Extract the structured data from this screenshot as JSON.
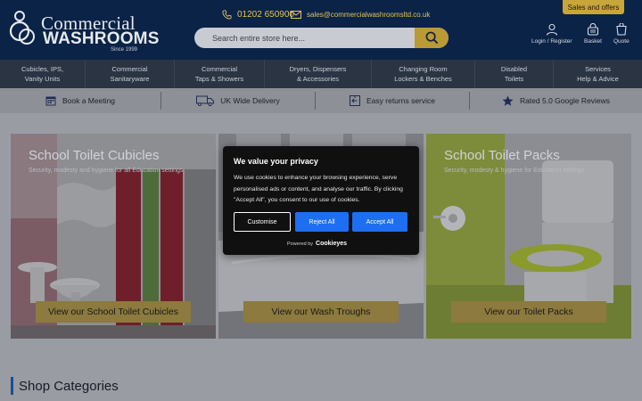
{
  "header": {
    "logo": {
      "line1": "Commercial",
      "line2": "WASHROOMS",
      "since": "Since 1999"
    },
    "phone": "01202 650900",
    "email": "sales@commercialwashroomsltd.co.uk",
    "search_placeholder": "Search entire store here...",
    "sales_button": "Sales and offers",
    "actions": {
      "login": "Login / Register",
      "basket": "Basket",
      "quote": "Quote"
    },
    "colors": {
      "background": "#0b2347",
      "accent": "#c9a63a"
    }
  },
  "nav": [
    {
      "line1": "Cubicles, IPS,",
      "line2": "Vanity Units"
    },
    {
      "line1": "Commercial",
      "line2": "Sanitaryware"
    },
    {
      "line1": "Commercial",
      "line2": "Taps & Showers"
    },
    {
      "line1": "Dryers, Dispensers",
      "line2": "& Accessories"
    },
    {
      "line1": "Changing Room",
      "line2": "Lockers & Benches"
    },
    {
      "line1": "Disabled",
      "line2": "Toilets"
    },
    {
      "line1": "Services",
      "line2": "Help & Advice"
    }
  ],
  "usp": [
    {
      "label": "Book a Meeting",
      "icon": "calendar-icon"
    },
    {
      "label": "UK Wide Delivery",
      "icon": "truck-icon"
    },
    {
      "label": "Easy returns service",
      "icon": "returns-icon"
    },
    {
      "label": "Rated 5.0 Google Reviews",
      "icon": "star-icon"
    }
  ],
  "promos": [
    {
      "title": "School Toilet Cubicles",
      "subtitle": "Security, modesty and hygiene for all Education settings",
      "button": "View our School Toilet Cubicles"
    },
    {
      "title": "",
      "subtitle": "",
      "button": "View our Wash Troughs"
    },
    {
      "title": "School Toilet Packs",
      "subtitle": "Security, modesty & hygiene for Education settings",
      "button": "View our Toilet Packs"
    }
  ],
  "shop_categories": {
    "title": "Shop Categories"
  },
  "cookie": {
    "title": "We value your privacy",
    "text": "We use cookies to enhance your browsing experience, serve personalised ads or content, and analyse our traffic. By clicking \"Accept All\", you consent to our use of cookies.",
    "customise": "Customise",
    "reject": "Reject All",
    "accept": "Accept All",
    "powered_by": "Powered by",
    "brand": "Cookieyes",
    "accent_color": "#1d6ef2"
  }
}
